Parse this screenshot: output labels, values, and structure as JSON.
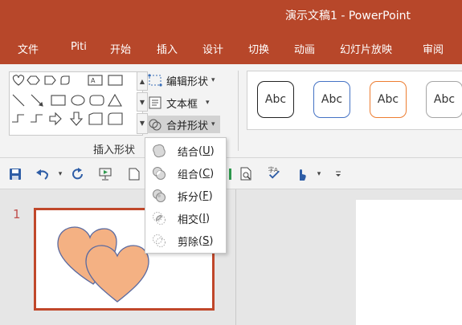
{
  "window": {
    "title": "演示文稿1  -  PowerPoint"
  },
  "tabs": [
    "文件",
    "Piti",
    "开始",
    "插入",
    "设计",
    "切换",
    "动画",
    "幻灯片放映",
    "审阅"
  ],
  "ribbon": {
    "edit_shape_label": "编辑形状",
    "textbox_label": "文本框",
    "merge_shapes_label": "合并形状",
    "group_label": "插入形状",
    "style_sample_text": "Abc"
  },
  "merge_menu": {
    "items": [
      {
        "label": "结合",
        "key": "U",
        "icon": "union-icon"
      },
      {
        "label": "组合",
        "key": "C",
        "icon": "combine-icon"
      },
      {
        "label": "拆分",
        "key": "F",
        "icon": "fragment-icon"
      },
      {
        "label": "相交",
        "key": "I",
        "icon": "intersect-icon"
      },
      {
        "label": "剪除",
        "key": "S",
        "icon": "subtract-icon"
      }
    ]
  },
  "slides_pane": {
    "slide_number": "1"
  },
  "colors": {
    "accent": "#b7472a",
    "heart_fill": "#f4b183",
    "heart_stroke": "#5a6aa0",
    "style_outlines": [
      "#222222",
      "#4472c4",
      "#ed7d31",
      "#a5a5a5"
    ]
  }
}
